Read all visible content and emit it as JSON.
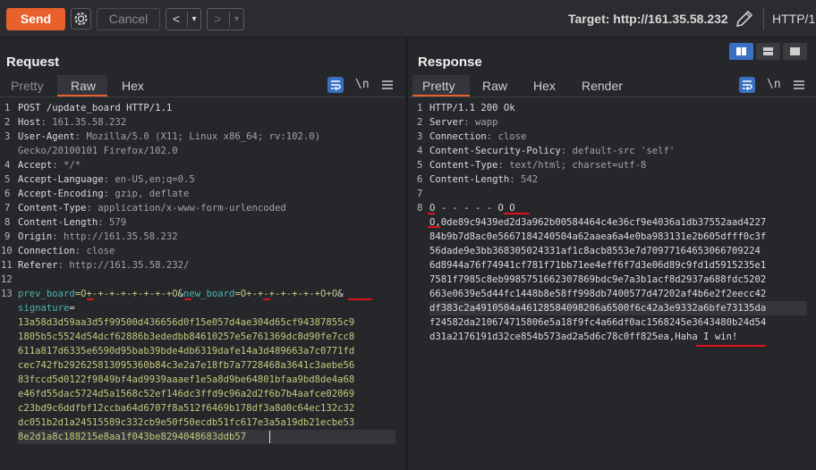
{
  "toolbar": {
    "send_label": "Send",
    "cancel_label": "Cancel",
    "prev_symbol": "<",
    "next_symbol": ">",
    "dropdown_symbol": "▾",
    "target_label": "Target: http://161.35.58.232",
    "protocol_label": "HTTP/1",
    "accent_color": "#e8602c"
  },
  "request": {
    "title": "Request",
    "tabs": [
      {
        "label": "Pretty",
        "active": false
      },
      {
        "label": "Raw",
        "active": true
      },
      {
        "label": "Hex",
        "active": false
      }
    ],
    "newline_label": "\\n",
    "lines": {
      "l1_num": "1",
      "l1": "POST /update_board HTTP/1.1",
      "l2_num": "2",
      "l2_key": "Host",
      "l2_val": ": 161.35.58.232",
      "l3_num": "3",
      "l3_key": "User-Agent",
      "l3_val": ": Mozilla/5.0 (X11; Linux x86_64; rv:102.0)",
      "l3b_val": "Gecko/20100101 Firefox/102.0",
      "l4_num": "4",
      "l4_key": "Accept",
      "l4_val": ": */*",
      "l5_num": "5",
      "l5_key": "Accept-Language",
      "l5_val": ": en-US,en;q=0.5",
      "l6_num": "6",
      "l6_key": "Accept-Encoding",
      "l6_val": ": gzip, deflate",
      "l7_num": "7",
      "l7_key": "Content-Type",
      "l7_val": ": application/x-www-form-urlencoded",
      "l8_num": "8",
      "l8_key": "Content-Length",
      "l8_val": ": 579",
      "l9_num": "9",
      "l9_key": "Origin",
      "l9_val": ": http://161.35.58.232",
      "l10_num": "10",
      "l10_key": "Connection",
      "l10_val": ": close",
      "l11_num": "11",
      "l11_key": "Referer",
      "l11_val": ": http://161.35.58.232/",
      "l12_num": "12",
      "l13_num": "13",
      "body_p1_name": "prev_board",
      "body_p1_val": "=O+-+-+-+-+-+-+-+O",
      "body_amp1": "&",
      "body_p2_name": "new_board",
      "body_p2_val": "=O+-+-+-+-+-+-+O+O",
      "body_amp2": "&",
      "body_p3_name": "signature",
      "body_p3_eq": "=",
      "sig": [
        "13a58d3d59aa3d5f99500d436656d0f15e057d4ae304d65cf94387855c9",
        "1805b5c5524d54dcf62886b3ededbb84610257e5e761369dc8d90fe7cc8",
        "611a817d6335e6590d95bab39bde4db6319dafe14a3d489663a7c0771fd",
        "cec742fb292625813095360b84c3e2a7e18fb7a7728468a3641c3aebe56",
        "83fccd5d0122f9849bf4ad9939aaaef1e5a8d9be64801bfaa9bd8de4a68",
        "e46fd55dac5724d5a1568c52ef146dc3ffd9c96a2d2f6b7b4aafce02069",
        "c23bd9c6ddfbf12ccba64d6707f8a512f6469b178df3a8d0c64ec132c32",
        "dc051b2d1a24515589c332cb9e50f50ecdb51fc617e3a5a19db21ecbe53",
        "8e2d1a8c188215e8aa1f043be8294048683ddb57"
      ]
    }
  },
  "response": {
    "title": "Response",
    "tabs": [
      {
        "label": "Pretty",
        "active": true
      },
      {
        "label": "Raw",
        "active": false
      },
      {
        "label": "Hex",
        "active": false
      },
      {
        "label": "Render",
        "active": false
      }
    ],
    "newline_label": "\\n",
    "lines": {
      "l1_num": "1",
      "l1": "HTTP/1.1 200 Ok",
      "l2_num": "2",
      "l2_key": "Server",
      "l2_val": ": wapp",
      "l3_num": "3",
      "l3_key": "Connection",
      "l3_val": ": close",
      "l4_num": "4",
      "l4_key": "Content-Security-Policy",
      "l4_val": ": default-src 'self'",
      "l5_num": "5",
      "l5_key": "Content-Type",
      "l5_val": ": text/html; charset=utf-8",
      "l6_num": "6",
      "l6_key": "Content-Length",
      "l6_val": ": 542",
      "l7_num": "7",
      "l8_num": "8",
      "board": "O - - - - - O O",
      "body": [
        "O,0de89c9439ed2d3a962b00584464c4e36cf9e4036a1db37552aad4227",
        "84b9b7d8ac0e5667184240504a62aaea6a4e0ba983131e2b605dfff0c3f",
        "56dade9e3bb368305024331af1c8acb8553e7d70977164653066709224",
        "6d8944a76f74941cf781f71bb71ee4eff6f7d3e06d89c9fd1d5915235e1",
        "7581f7985c8eb9985751662307869bdc9e7a3b1acf8d2937a688fdc5202",
        "663e0639e5d44fc1448b8e58ff998db7400577d47202af4b6e2f2eecc42",
        "df383c2a4910504a46128584098206a6500f6c42a3e9332a6bfe73135da",
        "f24582da210674715806e5a18f9fc4a66df0ac1568245e3643480b24d54",
        "d31a2176191d32ce854b573ad2a5d6c78c0ff825ea"
      ],
      "win_text": ",Haha I win!"
    }
  }
}
